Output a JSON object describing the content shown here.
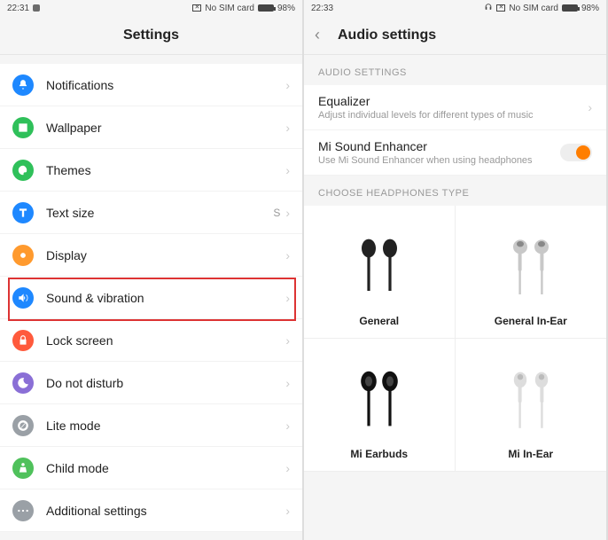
{
  "left": {
    "status": {
      "time": "22:31",
      "sim": "No SIM card",
      "battery": "98%"
    },
    "title": "Settings",
    "items": [
      {
        "label": "Notifications",
        "icon": "bell-icon",
        "color": "#1e88ff"
      },
      {
        "label": "Wallpaper",
        "icon": "image-icon",
        "color": "#2fc05a"
      },
      {
        "label": "Themes",
        "icon": "palette-icon",
        "color": "#2fc05a"
      },
      {
        "label": "Text size",
        "icon": "text-icon",
        "color": "#1e88ff",
        "extra": "S"
      },
      {
        "label": "Display",
        "icon": "brightness-icon",
        "color": "#ff9a2e"
      },
      {
        "label": "Sound & vibration",
        "icon": "volume-icon",
        "color": "#1e88ff",
        "highlight": true
      },
      {
        "label": "Lock screen",
        "icon": "lock-icon",
        "color": "#ff5a3c"
      },
      {
        "label": "Do not disturb",
        "icon": "moon-icon",
        "color": "#8a6fd6"
      },
      {
        "label": "Lite mode",
        "icon": "circle-slash-icon",
        "color": "#9aa0a6"
      },
      {
        "label": "Child mode",
        "icon": "child-icon",
        "color": "#4fc15b"
      },
      {
        "label": "Additional settings",
        "icon": "more-icon",
        "color": "#9aa0a6"
      }
    ]
  },
  "right": {
    "status": {
      "time": "22:33",
      "sim": "No SIM card",
      "battery": "98%"
    },
    "title": "Audio settings",
    "section1": "AUDIO SETTINGS",
    "equalizer": {
      "title": "Equalizer",
      "sub": "Adjust individual levels for different types of music"
    },
    "enhancer": {
      "title": "Mi Sound Enhancer",
      "sub": "Use Mi Sound Enhancer when using headphones",
      "enabled": true
    },
    "section2": "CHOOSE HEADPHONES TYPE",
    "headphones": [
      {
        "label": "General"
      },
      {
        "label": "General In-Ear"
      },
      {
        "label": "Mi Earbuds"
      },
      {
        "label": "Mi In-Ear"
      }
    ]
  }
}
